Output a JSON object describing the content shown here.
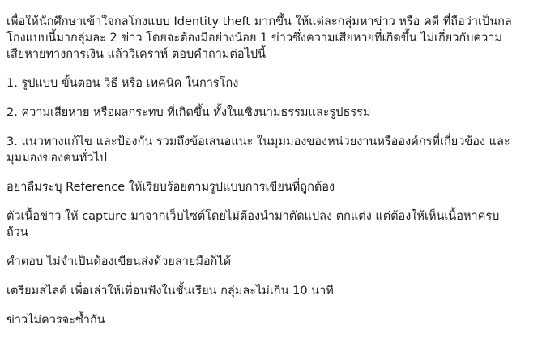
{
  "document": {
    "intro": [
      "เพื่อให้นักศึกษาเข้าใจกลโกงแบบ Identity theft มากขึ้น ให้แต่ละกลุ่มหาข่าว หรือ คดี ที่ถือว่าเป็นกล",
      "โกงแบบนี้มากลุ่มละ 2 ข่าว โดยจะต้องมีอย่างน้อย 1 ข่าวซึ่งความเสียหายที่เกิดขึ้น ไม่เกี่ยวกับความ",
      "เสียหายทางการเงิน แล้ววิเคราห์ ตอบคำถามต่อไปนี้"
    ],
    "q1": "1. รูปแบบ ขั้นตอน วิธี หรือ เทคนิค ในการโกง",
    "q2": "2. ความเสียหาย หรือผลกระทบ ที่เกิดขึ้น ทั้งในเชิงนามธรรมและรูปธรรม",
    "q3": [
      "3. แนวทางแก้ไข และป้องกัน รวมถึงข้อเสนอแนะ ในมุมมองของหน่วยงานหรือองค์กรที่เกี่ยวข้อง และ",
      "มุมมองของคนทั่วไป"
    ],
    "reference": "อย่าลืมระบุ Reference ให้เรียบร้อยตามรูปแบบการเขียนที่ถูกต้อง",
    "capture": [
      "ตัวเนื้อข่าว ให้ capture มาจากเว็บไซต์โดยไม่ต้องนำมาตัดแปลง ตกแต่ง แต่ต้องให้เห็นเนื้อหาครบ",
      "ถ้วน"
    ],
    "answer": "คำตอบ ไม่จำเป็นต้องเขียนส่งด้วยลายมือก็ได้",
    "slides": "เตรียมสไลด์ เพื่อเล่าให้เพื่อนฟังในชั้นเรียน กลุ่มละไม่เกิน 10 นาที",
    "no_duplicate": "ข่าวไม่ควรจะซ้ำกัน"
  }
}
